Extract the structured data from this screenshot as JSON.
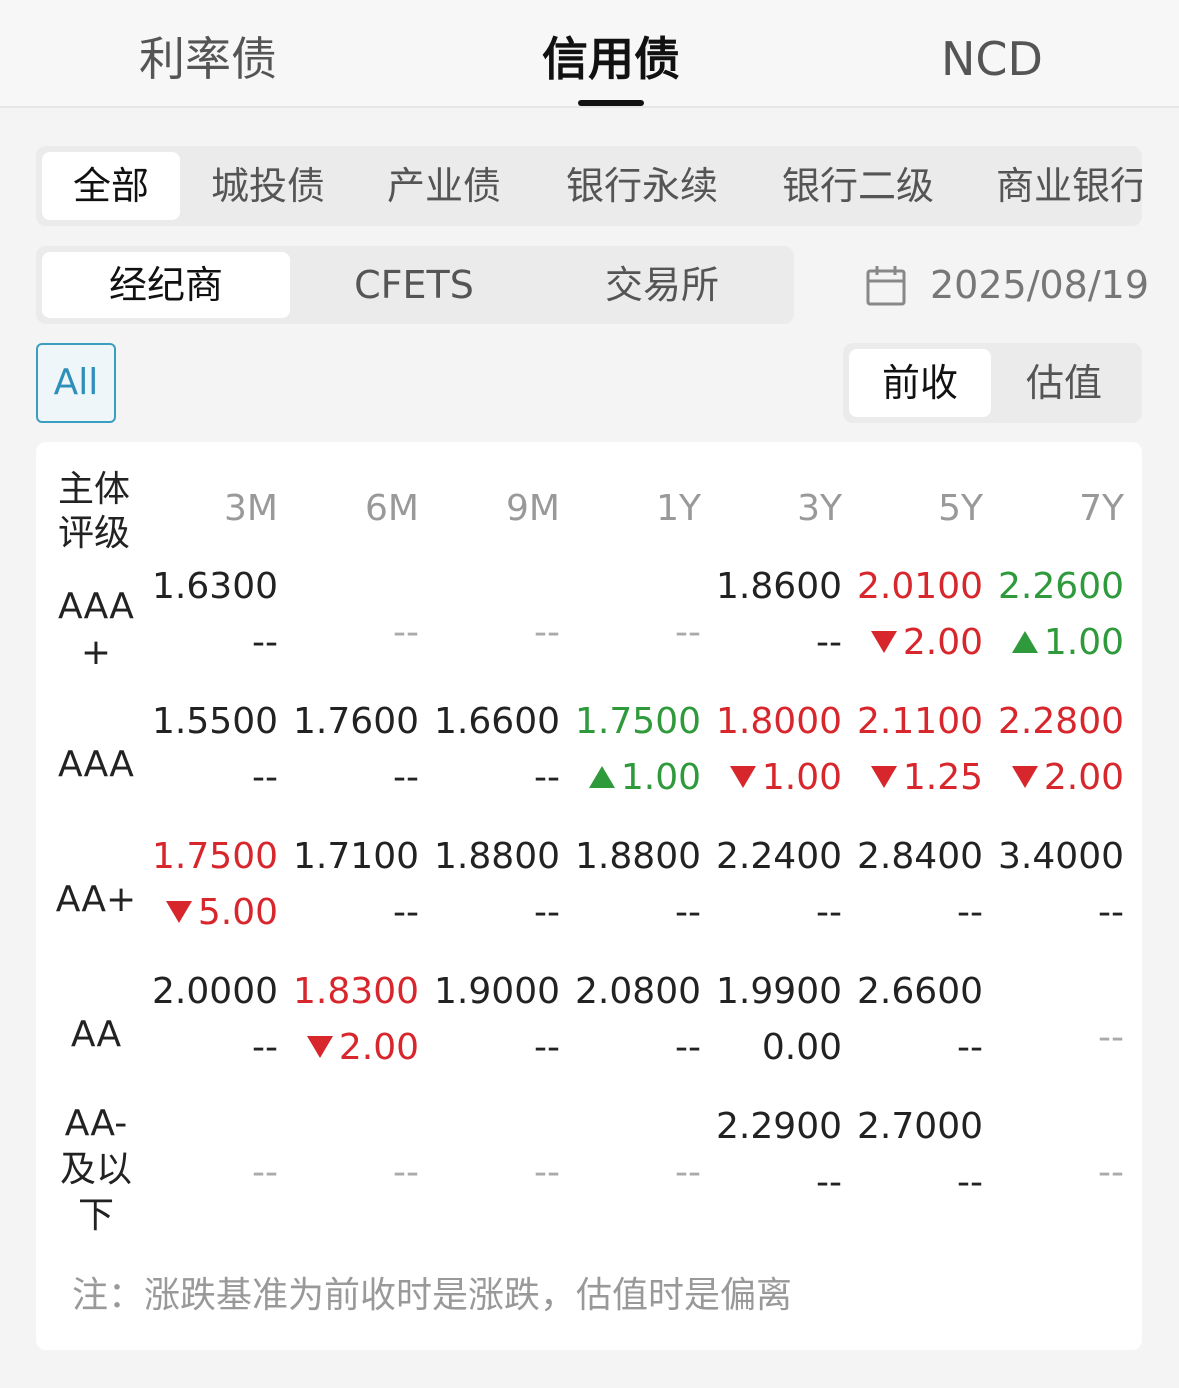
{
  "top_tabs": [
    "利率债",
    "信用债",
    "NCD"
  ],
  "categories": [
    "全部",
    "城投债",
    "产业债",
    "银行永续",
    "银行二级",
    "商业银行"
  ],
  "markets": [
    "经纪商",
    "CFETS",
    "交易所"
  ],
  "date": "2025/08/19",
  "filter_chip": "All",
  "modes": [
    "前收",
    "估值"
  ],
  "table": {
    "rating_header_l1": "主体",
    "rating_header_l2": "评级",
    "columns": [
      "3M",
      "6M",
      "9M",
      "1Y",
      "3Y",
      "5Y",
      "7Y"
    ],
    "rows": [
      {
        "label_lines": [
          "AAA",
          "+"
        ],
        "cells": [
          {
            "value": "1.6300",
            "change": "--",
            "dir": ""
          },
          {
            "value": "",
            "change": "--",
            "dir": "",
            "empty": true
          },
          {
            "value": "",
            "change": "--",
            "dir": "",
            "empty": true
          },
          {
            "value": "",
            "change": "--",
            "dir": "",
            "empty": true
          },
          {
            "value": "1.8600",
            "change": "--",
            "dir": ""
          },
          {
            "value": "2.0100",
            "change": "2.00",
            "dir": "down"
          },
          {
            "value": "2.2600",
            "change": "1.00",
            "dir": "up"
          }
        ]
      },
      {
        "label_lines": [
          "AAA"
        ],
        "cells": [
          {
            "value": "1.5500",
            "change": "--",
            "dir": ""
          },
          {
            "value": "1.7600",
            "change": "--",
            "dir": ""
          },
          {
            "value": "1.6600",
            "change": "--",
            "dir": ""
          },
          {
            "value": "1.7500",
            "change": "1.00",
            "dir": "up"
          },
          {
            "value": "1.8000",
            "change": "1.00",
            "dir": "down"
          },
          {
            "value": "2.1100",
            "change": "1.25",
            "dir": "down"
          },
          {
            "value": "2.2800",
            "change": "2.00",
            "dir": "down"
          }
        ]
      },
      {
        "label_lines": [
          "AA+"
        ],
        "cells": [
          {
            "value": "1.7500",
            "change": "5.00",
            "dir": "down"
          },
          {
            "value": "1.7100",
            "change": "--",
            "dir": ""
          },
          {
            "value": "1.8800",
            "change": "--",
            "dir": ""
          },
          {
            "value": "1.8800",
            "change": "--",
            "dir": ""
          },
          {
            "value": "2.2400",
            "change": "--",
            "dir": ""
          },
          {
            "value": "2.8400",
            "change": "--",
            "dir": ""
          },
          {
            "value": "3.4000",
            "change": "--",
            "dir": ""
          }
        ]
      },
      {
        "label_lines": [
          "AA"
        ],
        "cells": [
          {
            "value": "2.0000",
            "change": "--",
            "dir": ""
          },
          {
            "value": "1.8300",
            "change": "2.00",
            "dir": "down"
          },
          {
            "value": "1.9000",
            "change": "--",
            "dir": ""
          },
          {
            "value": "2.0800",
            "change": "--",
            "dir": ""
          },
          {
            "value": "1.9900",
            "change": "0.00",
            "dir": ""
          },
          {
            "value": "2.6600",
            "change": "--",
            "dir": ""
          },
          {
            "value": "",
            "change": "--",
            "dir": "",
            "empty": true
          }
        ]
      },
      {
        "label_lines": [
          "AA-",
          "及以",
          "下"
        ],
        "cells": [
          {
            "value": "",
            "change": "--",
            "dir": "",
            "empty": true
          },
          {
            "value": "",
            "change": "--",
            "dir": "",
            "empty": true
          },
          {
            "value": "",
            "change": "--",
            "dir": "",
            "empty": true
          },
          {
            "value": "",
            "change": "--",
            "dir": "",
            "empty": true
          },
          {
            "value": "2.2900",
            "change": "--",
            "dir": ""
          },
          {
            "value": "2.7000",
            "change": "--",
            "dir": ""
          },
          {
            "value": "",
            "change": "--",
            "dir": "",
            "empty": true
          }
        ]
      }
    ]
  },
  "note": "注：涨跌基准为前收时是涨跌，估值时是偏离",
  "colors": {
    "up": "#2f9a3b",
    "down": "#d8262d",
    "accent": "#3a9fbf"
  }
}
